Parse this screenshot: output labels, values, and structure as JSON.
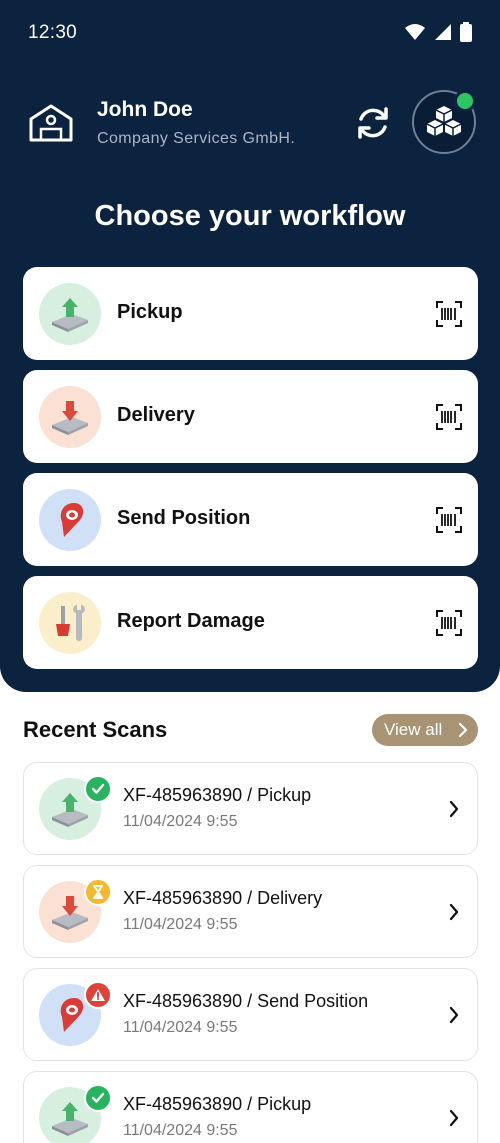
{
  "status_bar": {
    "time": "12:30",
    "icons": [
      "wifi-icon",
      "signal-icon",
      "battery-icon"
    ]
  },
  "profile": {
    "name": "John Doe",
    "company": "Company Services GmbH."
  },
  "heading": "Choose your workflow",
  "workflows": [
    {
      "label": "Pickup",
      "icon": "pickup-icon",
      "bg": "#d6efdf"
    },
    {
      "label": "Delivery",
      "icon": "delivery-icon",
      "bg": "#fbe0d4"
    },
    {
      "label": "Send Position",
      "icon": "location-pin-icon",
      "bg": "#cfe0f7"
    },
    {
      "label": "Report Damage",
      "icon": "tools-icon",
      "bg": "#fbefcb"
    }
  ],
  "recent": {
    "title": "Recent Scans",
    "view_all": "View all",
    "items": [
      {
        "title": "XF-485963890 / Pickup",
        "date": "11/04/2024 9:55",
        "status": "done",
        "badge_color": "#27b35f"
      },
      {
        "title": "XF-485963890 / Delivery",
        "date": "11/04/2024 9:55",
        "status": "pending",
        "badge_color": "#f5b82e"
      },
      {
        "title": "XF-485963890 / Send Position",
        "date": "11/04/2024 9:55",
        "status": "error",
        "badge_color": "#e0413a"
      },
      {
        "title": "XF-485963890 / Pickup",
        "date": "11/04/2024 9:55",
        "status": "done",
        "badge_color": "#27b35f"
      }
    ]
  },
  "colors": {
    "navy": "#0c2340",
    "accent": "#a89374",
    "online": "#2bc765"
  }
}
